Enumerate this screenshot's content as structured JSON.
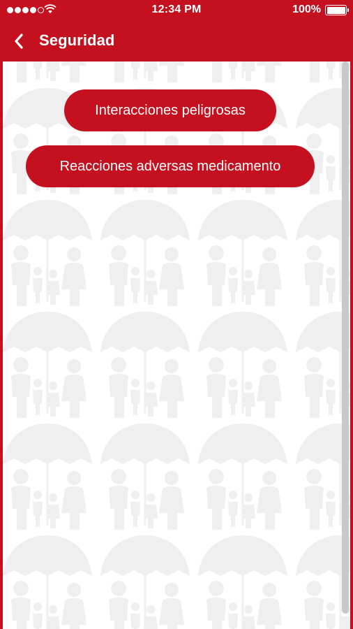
{
  "status_bar": {
    "signal_bars_filled": 4,
    "signal_bars_total": 5,
    "wifi_icon": "wifi-icon",
    "time": "12:34 PM",
    "battery_percent": "100%",
    "battery_level": 1.0
  },
  "nav_bar": {
    "back_icon": "chevron-left-icon",
    "title": "Seguridad"
  },
  "colors": {
    "brand_red": "#c5111f",
    "content_bg": "#ffffff",
    "watermark": "#efefef"
  },
  "actions": [
    {
      "label": "Interacciones peligrosas"
    },
    {
      "label": "Reacciones adversas medicamento"
    }
  ]
}
